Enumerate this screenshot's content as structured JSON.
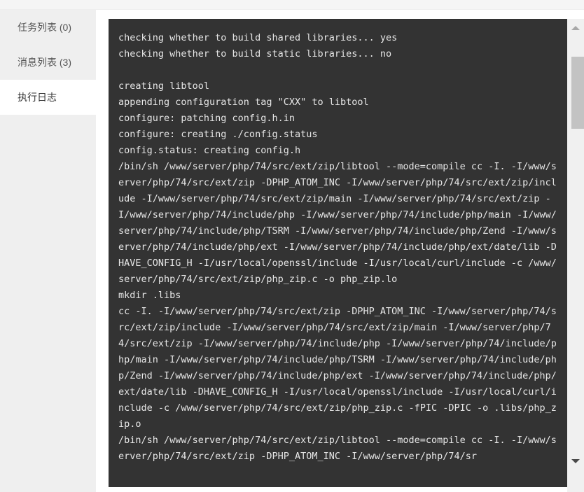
{
  "window": {
    "title": "执行日志"
  },
  "sidebar": {
    "items": [
      {
        "label": "任务列表 (0)",
        "active": false
      },
      {
        "label": "消息列表 (3)",
        "active": false
      },
      {
        "label": "执行日志",
        "active": true
      }
    ]
  },
  "log": {
    "title": "执行日志",
    "background_color": "#333333",
    "text_color": "#e6e6e6",
    "content": "checking whether to build shared libraries... yes\nchecking whether to build static libraries... no\n\ncreating libtool\nappending configuration tag \"CXX\" to libtool\nconfigure: patching config.h.in\nconfigure: creating ./config.status\nconfig.status: creating config.h\n/bin/sh /www/server/php/74/src/ext/zip/libtool --mode=compile cc -I. -I/www/server/php/74/src/ext/zip -DPHP_ATOM_INC -I/www/server/php/74/src/ext/zip/include -I/www/server/php/74/src/ext/zip/main -I/www/server/php/74/src/ext/zip -I/www/server/php/74/include/php -I/www/server/php/74/include/php/main -I/www/server/php/74/include/php/TSRM -I/www/server/php/74/include/php/Zend -I/www/server/php/74/include/php/ext -I/www/server/php/74/include/php/ext/date/lib -DHAVE_CONFIG_H -I/usr/local/openssl/include -I/usr/local/curl/include -c /www/server/php/74/src/ext/zip/php_zip.c -o php_zip.lo\nmkdir .libs\ncc -I. -I/www/server/php/74/src/ext/zip -DPHP_ATOM_INC -I/www/server/php/74/src/ext/zip/include -I/www/server/php/74/src/ext/zip/main -I/www/server/php/74/src/ext/zip -I/www/server/php/74/include/php -I/www/server/php/74/include/php/main -I/www/server/php/74/include/php/TSRM -I/www/server/php/74/include/php/Zend -I/www/server/php/74/include/php/ext -I/www/server/php/74/include/php/ext/date/lib -DHAVE_CONFIG_H -I/usr/local/openssl/include -I/usr/local/curl/include -c /www/server/php/74/src/ext/zip/php_zip.c -fPIC -DPIC -o .libs/php_zip.o\n/bin/sh /www/server/php/74/src/ext/zip/libtool --mode=compile cc -I. -I/www/server/php/74/src/ext/zip -DPHP_ATOM_INC -I/www/server/php/74/sr"
  },
  "scrollbar": {
    "up_arrow": "chevron-up-icon",
    "down_arrow": "chevron-down-icon",
    "thumb_color": "#c3c3c3",
    "track_color": "#f0f0f0"
  }
}
